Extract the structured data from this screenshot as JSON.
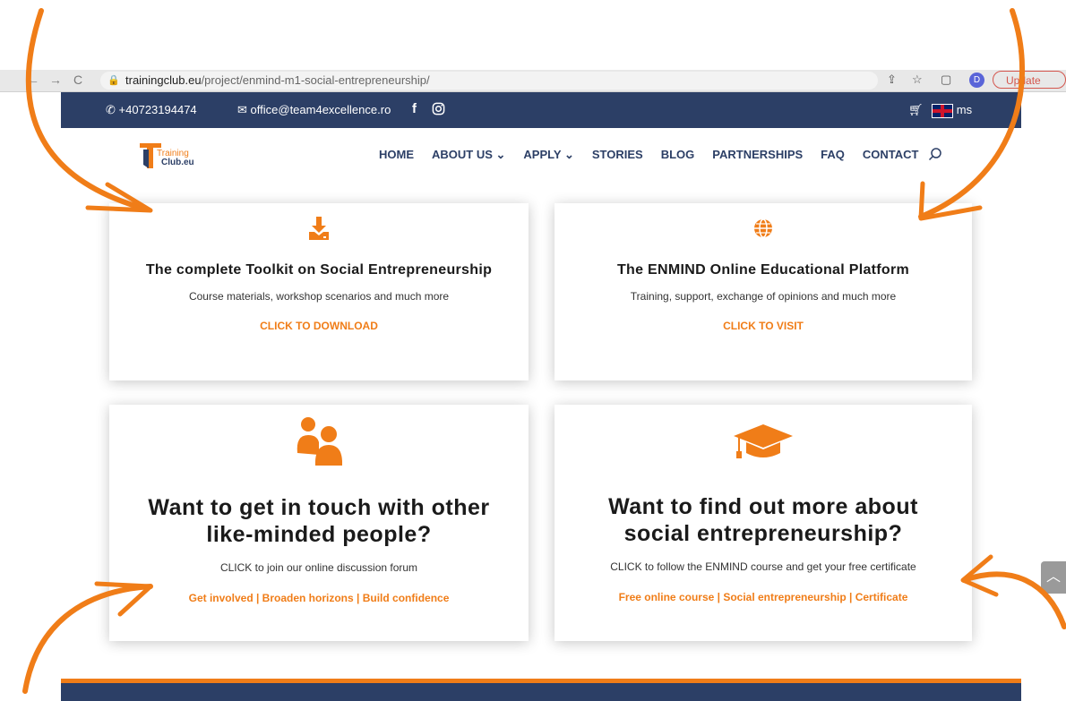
{
  "browser": {
    "url_domain": "trainingclub.eu",
    "url_path": "/project/enmind-m1-social-entrepreneurship/",
    "profile_initial": "D",
    "update_label": "Update"
  },
  "topbar": {
    "phone": "+40723194474",
    "email": "office@team4excellence.ro",
    "facebook": "f",
    "language": "ms"
  },
  "logo": {
    "line1": "Training",
    "line2": "Club.eu"
  },
  "nav": {
    "items": [
      "HOME",
      "ABOUT US",
      "APPLY",
      "STORIES",
      "BLOG",
      "PARTNERSHIPS",
      "FAQ",
      "CONTACT"
    ],
    "dropdown_items": [
      "ABOUT US",
      "APPLY"
    ]
  },
  "cards": [
    {
      "icon": "download-icon",
      "title": "The complete Toolkit on Social Entrepreneurship",
      "description": "Course materials, workshop scenarios and much more",
      "link": "CLICK TO DOWNLOAD"
    },
    {
      "icon": "globe-icon",
      "title": "The ENMIND Online Educational Platform",
      "description": "Training, support, exchange of opinions and much more",
      "link": "CLICK TO VISIT"
    },
    {
      "icon": "people-icon",
      "title_line1": "Want to get in touch with other",
      "title_line2": "like-minded people?",
      "description": "CLICK to join our online discussion forum",
      "link": "Get involved | Broaden horizons | Build confidence"
    },
    {
      "icon": "graduation-cap-icon",
      "title_line1": "Want to find out more about",
      "title_line2": "social entrepreneurship?",
      "description": "CLICK to follow the ENMIND course and get your free certificate",
      "link": "Free online course | Social entrepreneurship | Certificate"
    }
  ],
  "colors": {
    "accent": "#f07d18",
    "navy": "#2c3f66"
  }
}
